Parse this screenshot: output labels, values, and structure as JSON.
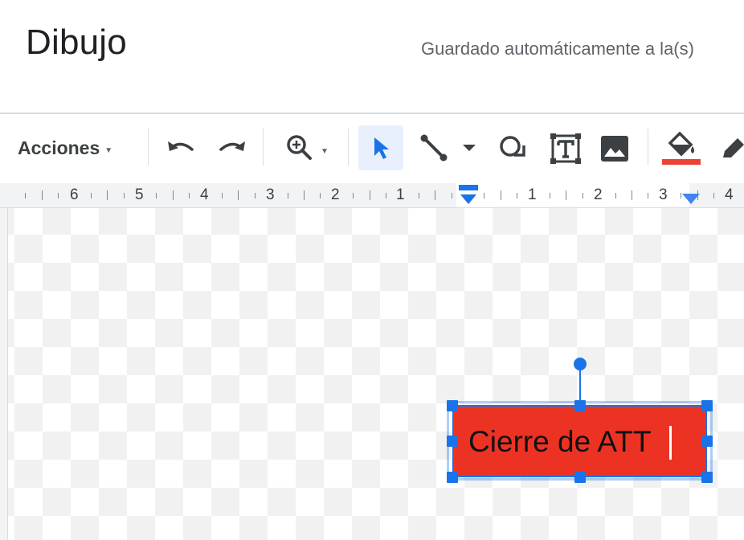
{
  "header": {
    "title": "Dibujo",
    "save_status": "Guardado automáticamente a la(s)"
  },
  "toolbar": {
    "actions_label": "Acciones",
    "icons": [
      "chevron-down-icon",
      "undo-icon",
      "redo-icon",
      "zoom-icon",
      "chevron-down-icon",
      "select-arrow-icon",
      "line-icon",
      "chevron-down-icon",
      "shape-icon",
      "textbox-icon",
      "image-icon",
      "fill-color-icon",
      "pen-icon"
    ],
    "fill_color": "#ea4335",
    "active_color": "#1a73e8"
  },
  "ruler": {
    "left_numbers": [
      "6",
      "5",
      "4",
      "3",
      "2",
      "1"
    ],
    "right_numbers": [
      "1",
      "2",
      "3",
      "4"
    ]
  },
  "shape": {
    "text": "Cierre de ATT",
    "fill": "#ec3323"
  }
}
